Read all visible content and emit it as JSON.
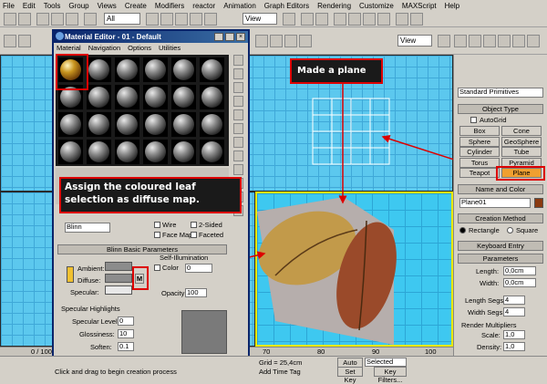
{
  "menu": [
    "File",
    "Edit",
    "Tools",
    "Group",
    "Views",
    "Create",
    "Modifiers",
    "reactor",
    "Animation",
    "Graph Editors",
    "Rendering",
    "Customize",
    "MAXScript",
    "Help"
  ],
  "toolbar": {
    "filter_value": "All",
    "view_value": "View",
    "view2_value": "View"
  },
  "material_editor": {
    "title": "Material Editor - 01 - Default",
    "menu": [
      "Material",
      "Navigation",
      "Options",
      "Utilities"
    ],
    "shader_value": "Blinn",
    "shader_options": {
      "wire": "Wire",
      "two_sided": "2-Sided",
      "face_map": "Face Map",
      "faceted": "Faceted"
    },
    "blinn_header": "Blinn Basic Parameters",
    "ambient": "Ambient:",
    "diffuse": "Diffuse:",
    "specular": "Specular:",
    "self_illum": "Self-Illumination",
    "color_label": "Color",
    "color_value": "0",
    "opacity_label": "Opacity:",
    "opacity_value": "100",
    "map_btn": "M",
    "spec_highlights": "Specular Highlights",
    "spec_level": "Specular Level:",
    "spec_level_value": "0",
    "glossiness": "Glossiness:",
    "glossiness_value": "10",
    "soften": "Soften:",
    "soften_value": "0.1"
  },
  "callouts": {
    "plane": "Made a plane",
    "assign": "Assign the coloured leaf selection as diffuse map."
  },
  "command_panel": {
    "dropdown": "Standard Primitives",
    "object_type": "Object Type",
    "autogrid": "AutoGrid",
    "buttons": [
      "Box",
      "Cone",
      "Sphere",
      "GeoSphere",
      "Cylinder",
      "Tube",
      "Torus",
      "Pyramid",
      "Teapot",
      "Plane"
    ],
    "name_color": "Name and Color",
    "object_name": "Plane01",
    "creation_method": "Creation Method",
    "rectangle": "Rectangle",
    "square": "Square",
    "keyboard_entry": "Keyboard Entry",
    "parameters": "Parameters",
    "length_label": "Length:",
    "length_value": "0,0cm",
    "width_label": "Width:",
    "width_value": "0,0cm",
    "length_segs_label": "Length Segs:",
    "length_segs_value": "4",
    "width_segs_label": "Width Segs:",
    "width_segs_value": "4",
    "render_mult": "Render Multipliers",
    "scale_label": "Scale:",
    "scale_value": "1,0",
    "density_label": "Density:",
    "density_value": "1,0"
  },
  "status": {
    "frame": "0 / 100",
    "grid": "Grid = 25,4cm",
    "auto_key": "Auto Key",
    "set_key": "Set Key",
    "selected": "Selected",
    "key_filters": "Key Filters...",
    "add_time_tag": "Add Time Tag",
    "prompt": "Click and drag to begin creation process"
  },
  "ruler_ticks": [
    "70",
    "80",
    "90",
    "100"
  ],
  "accent_colors": {
    "callout_border": "#dd0000",
    "viewport": "#5cc8ee",
    "title_bar": "#0a246a",
    "selected_button": "#f0a030"
  }
}
